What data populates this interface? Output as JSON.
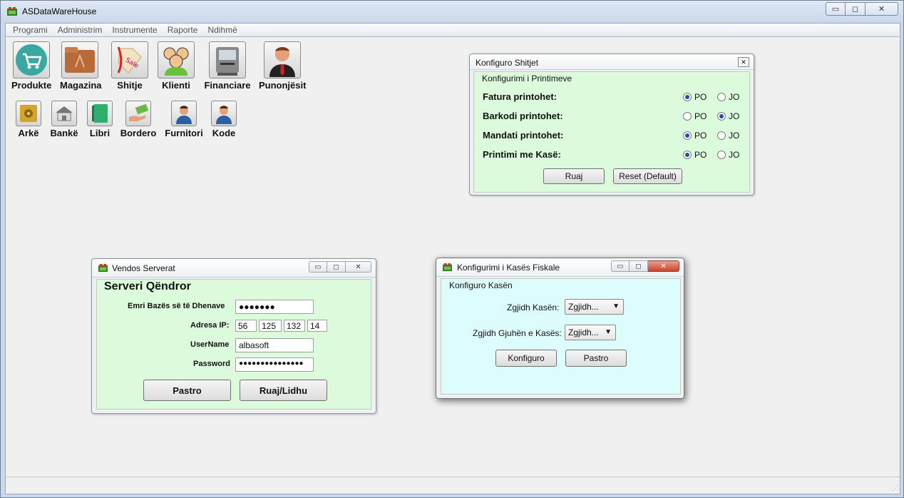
{
  "app": {
    "title": "ASDataWareHouse"
  },
  "window_controls": {
    "minimize": "▭",
    "maximize": "◻",
    "close": "✕"
  },
  "menu": [
    "Programi",
    "Administrim",
    "Instrumente",
    "Raporte",
    "Ndihmë"
  ],
  "launcher_large": [
    {
      "label": "Produkte",
      "icon": "shopping-cart-icon"
    },
    {
      "label": "Magazina",
      "icon": "folder-icon"
    },
    {
      "label": "Shitje",
      "icon": "sale-tag-icon"
    },
    {
      "label": "Klienti",
      "icon": "users-group-icon"
    },
    {
      "label": "Financiare",
      "icon": "atm-machine-icon"
    },
    {
      "label": "Punonjësit",
      "icon": "employee-icon"
    }
  ],
  "launcher_small": [
    {
      "label": "Arkë",
      "icon": "safe-icon"
    },
    {
      "label": "Bankë",
      "icon": "bank-icon"
    },
    {
      "label": "Libri",
      "icon": "book-icon"
    },
    {
      "label": "Bordero",
      "icon": "money-hand-icon"
    },
    {
      "label": "Furnitori",
      "icon": "supplier-icon"
    },
    {
      "label": "Kode",
      "icon": "codes-icon"
    }
  ],
  "konfiguro_shitjet": {
    "title": "Konfiguro Shitjet",
    "group": "Konfigurimi i Printimeve",
    "rows": [
      {
        "label": "Fatura printohet:",
        "selected": "PO"
      },
      {
        "label": "Barkodi printohet:",
        "selected": "JO"
      },
      {
        "label": "Mandati printohet:",
        "selected": "PO"
      },
      {
        "label": "Printimi me Kasë:",
        "selected": "PO"
      }
    ],
    "opt_yes": "PO",
    "opt_no": "JO",
    "save": "Ruaj",
    "reset": "Reset (Default)",
    "panel_color": "#dcfbdc"
  },
  "vendos_serverat": {
    "title": "Vendos Serverat",
    "heading": "Serveri Qëndror",
    "db_label": "Emri Bazës së të Dhenave",
    "db_value": "●●●●●●●",
    "ip_label": "Adresa IP:",
    "ip": [
      "56",
      "125",
      "132",
      "14"
    ],
    "user_label": "UserName",
    "user_value": "albasoft",
    "pass_label": "Password",
    "pass_value": "●●●●●●●●●●●●●●●",
    "clear": "Pastro",
    "save": "Ruaj/Lidhu",
    "panel_color": "#dcfbdc"
  },
  "kasa_fiskale": {
    "title": "Konfigurimi i Kasës Fiskale",
    "group": "Konfiguro Kasën",
    "select_cash_label": "Zgjidh Kasën:",
    "select_cash_value": "Zgjidh...",
    "select_lang_label": "Zgjidh Gjuhën e Kasës:",
    "select_lang_value": "Zgjidh...",
    "configure": "Konfiguro",
    "clear": "Pastro",
    "panel_color": "#dcfdfb"
  }
}
